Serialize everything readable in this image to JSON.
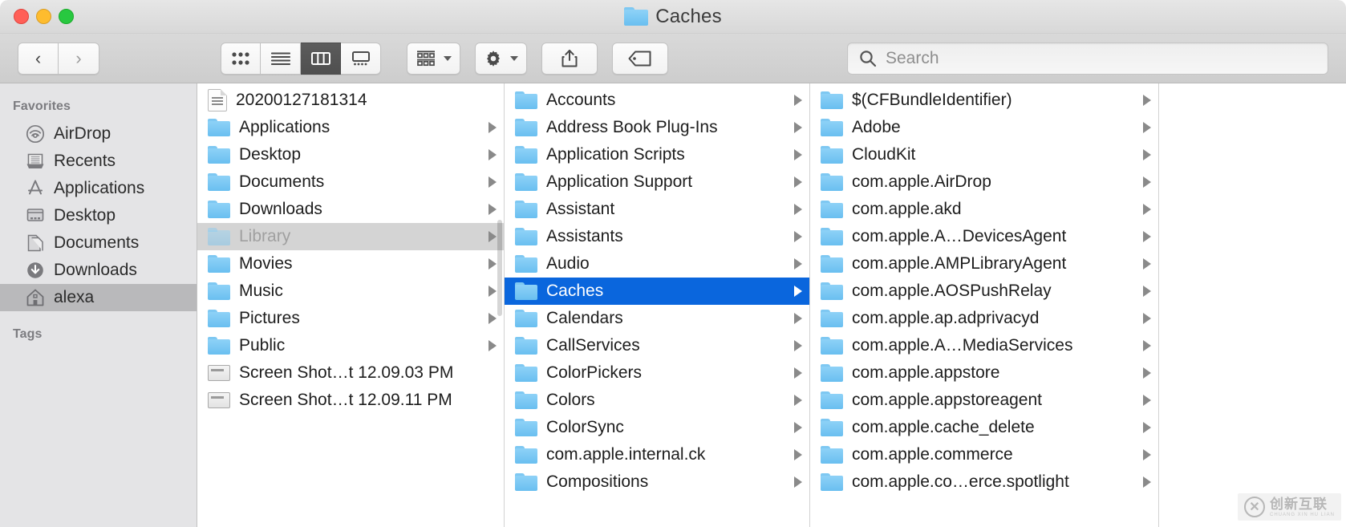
{
  "window": {
    "title": "Caches",
    "title_icon": "folder-icon",
    "traffic_lights": [
      {
        "name": "close",
        "color": "#ff5f57"
      },
      {
        "name": "minimize",
        "color": "#febc2e"
      },
      {
        "name": "zoom",
        "color": "#28c840"
      }
    ]
  },
  "toolbar": {
    "back_label": "‹",
    "forward_label": "›",
    "view_modes": [
      {
        "name": "icon-view",
        "selected": false
      },
      {
        "name": "list-view",
        "selected": false
      },
      {
        "name": "column-view",
        "selected": true
      },
      {
        "name": "gallery-view",
        "selected": false
      }
    ],
    "group_button": "group-by-icon",
    "action_button": "gear-icon",
    "share_button": "share-icon",
    "tag_button": "tag-icon"
  },
  "search": {
    "placeholder": "Search",
    "value": "",
    "icon": "search-icon"
  },
  "sidebar": {
    "sections": [
      {
        "header": "Favorites",
        "items": [
          {
            "label": "AirDrop",
            "icon": "airdrop-icon",
            "selected": false
          },
          {
            "label": "Recents",
            "icon": "recents-icon",
            "selected": false
          },
          {
            "label": "Applications",
            "icon": "applications-icon",
            "selected": false
          },
          {
            "label": "Desktop",
            "icon": "desktop-icon",
            "selected": false
          },
          {
            "label": "Documents",
            "icon": "documents-icon",
            "selected": false
          },
          {
            "label": "Downloads",
            "icon": "downloads-icon",
            "selected": false
          },
          {
            "label": "alexa",
            "icon": "home-icon",
            "selected": true
          }
        ]
      },
      {
        "header": "Tags",
        "items": []
      }
    ]
  },
  "columns": [
    {
      "name": "column-home",
      "rows": [
        {
          "label": "20200127181314",
          "icon": "document-icon",
          "arrow": false,
          "selected": "none"
        },
        {
          "label": "Applications",
          "icon": "folder-applications-icon",
          "arrow": true,
          "selected": "none"
        },
        {
          "label": "Desktop",
          "icon": "folder-desktop-icon",
          "arrow": true,
          "selected": "none"
        },
        {
          "label": "Documents",
          "icon": "folder-documents-icon",
          "arrow": true,
          "selected": "none"
        },
        {
          "label": "Downloads",
          "icon": "folder-downloads-icon",
          "arrow": true,
          "selected": "none"
        },
        {
          "label": "Library",
          "icon": "folder-library-icon",
          "arrow": true,
          "selected": "gray"
        },
        {
          "label": "Movies",
          "icon": "folder-movies-icon",
          "arrow": true,
          "selected": "none"
        },
        {
          "label": "Music",
          "icon": "folder-music-icon",
          "arrow": true,
          "selected": "none"
        },
        {
          "label": "Pictures",
          "icon": "folder-pictures-icon",
          "arrow": true,
          "selected": "none"
        },
        {
          "label": "Public",
          "icon": "folder-public-icon",
          "arrow": true,
          "selected": "none"
        },
        {
          "label": "Screen Shot…t 12.09.03 PM",
          "icon": "screenshot-icon",
          "arrow": false,
          "selected": "none"
        },
        {
          "label": "Screen Shot…t 12.09.11 PM",
          "icon": "screenshot-icon",
          "arrow": false,
          "selected": "none"
        }
      ]
    },
    {
      "name": "column-library",
      "rows": [
        {
          "label": "Accounts",
          "icon": "folder-icon",
          "arrow": true,
          "selected": "none"
        },
        {
          "label": "Address Book Plug-Ins",
          "icon": "folder-icon",
          "arrow": true,
          "selected": "none"
        },
        {
          "label": "Application Scripts",
          "icon": "folder-icon",
          "arrow": true,
          "selected": "none"
        },
        {
          "label": "Application Support",
          "icon": "folder-icon",
          "arrow": true,
          "selected": "none"
        },
        {
          "label": "Assistant",
          "icon": "folder-icon",
          "arrow": true,
          "selected": "none"
        },
        {
          "label": "Assistants",
          "icon": "folder-icon",
          "arrow": true,
          "selected": "none"
        },
        {
          "label": "Audio",
          "icon": "folder-icon",
          "arrow": true,
          "selected": "none"
        },
        {
          "label": "Caches",
          "icon": "folder-icon",
          "arrow": true,
          "selected": "blue"
        },
        {
          "label": "Calendars",
          "icon": "folder-icon",
          "arrow": true,
          "selected": "none"
        },
        {
          "label": "CallServices",
          "icon": "folder-icon",
          "arrow": true,
          "selected": "none"
        },
        {
          "label": "ColorPickers",
          "icon": "folder-icon",
          "arrow": false,
          "selected": "none"
        },
        {
          "label": "Colors",
          "icon": "folder-icon",
          "arrow": false,
          "selected": "none"
        },
        {
          "label": "ColorSync",
          "icon": "folder-icon",
          "arrow": false,
          "selected": "none"
        },
        {
          "label": "com.apple.internal.ck",
          "icon": "folder-icon",
          "arrow": false,
          "selected": "none"
        },
        {
          "label": "Compositions",
          "icon": "folder-icon",
          "arrow": false,
          "selected": "none"
        }
      ]
    },
    {
      "name": "column-caches",
      "rows": [
        {
          "label": "$(CFBundleIdentifier)",
          "icon": "folder-icon",
          "arrow": true,
          "selected": "none"
        },
        {
          "label": "Adobe",
          "icon": "folder-icon",
          "arrow": true,
          "selected": "none"
        },
        {
          "label": "CloudKit",
          "icon": "folder-icon",
          "arrow": true,
          "selected": "none"
        },
        {
          "label": "com.apple.AirDrop",
          "icon": "folder-icon",
          "arrow": true,
          "selected": "none"
        },
        {
          "label": "com.apple.akd",
          "icon": "folder-icon",
          "arrow": true,
          "selected": "none"
        },
        {
          "label": "com.apple.A…DevicesAgent",
          "icon": "folder-icon",
          "arrow": true,
          "selected": "none"
        },
        {
          "label": "com.apple.AMPLibraryAgent",
          "icon": "folder-icon",
          "arrow": true,
          "selected": "none"
        },
        {
          "label": "com.apple.AOSPushRelay",
          "icon": "folder-icon",
          "arrow": true,
          "selected": "none"
        },
        {
          "label": "com.apple.ap.adprivacyd",
          "icon": "folder-icon",
          "arrow": true,
          "selected": "none"
        },
        {
          "label": "com.apple.A…MediaServices",
          "icon": "folder-icon",
          "arrow": true,
          "selected": "none"
        },
        {
          "label": "com.apple.appstore",
          "icon": "folder-icon",
          "arrow": true,
          "selected": "none"
        },
        {
          "label": "com.apple.appstoreagent",
          "icon": "folder-icon",
          "arrow": true,
          "selected": "none"
        },
        {
          "label": "com.apple.cache_delete",
          "icon": "folder-icon",
          "arrow": true,
          "selected": "none"
        },
        {
          "label": "com.apple.commerce",
          "icon": "folder-icon",
          "arrow": true,
          "selected": "none"
        },
        {
          "label": "com.apple.co…erce.spotlight",
          "icon": "folder-icon",
          "arrow": true,
          "selected": "none"
        }
      ]
    }
  ],
  "watermark": {
    "cn": "创新互联",
    "en": "CHUANG XIN HU LIAN",
    "logo": "x-circle-icon"
  },
  "colors": {
    "selection_blue": "#0a66dd",
    "selection_gray": "#d4d4d4",
    "folder_blue": "#69bff0",
    "sidebar_bg": "#e4e4e6"
  }
}
